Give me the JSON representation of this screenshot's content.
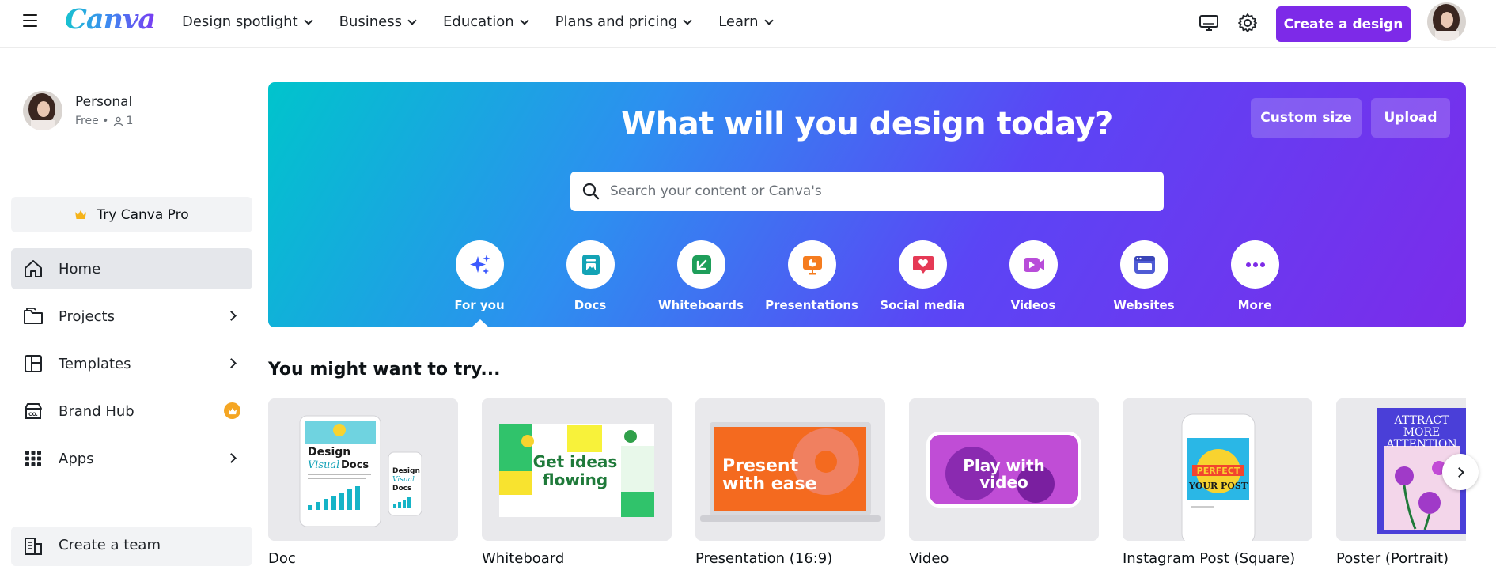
{
  "header": {
    "logo": "Canva",
    "menu": [
      {
        "label": "Design spotlight"
      },
      {
        "label": "Business"
      },
      {
        "label": "Education"
      },
      {
        "label": "Plans and pricing"
      },
      {
        "label": "Learn"
      }
    ],
    "create_button": "Create a design",
    "icons": [
      "monitor-icon",
      "gear-icon"
    ]
  },
  "sidebar": {
    "profile": {
      "name": "Personal",
      "plan": "Free",
      "members": "1"
    },
    "try_pro": "Try Canva Pro",
    "items": [
      {
        "label": "Home",
        "icon": "home-icon",
        "active": true
      },
      {
        "label": "Projects",
        "icon": "folder-icon"
      },
      {
        "label": "Templates",
        "icon": "templates-icon"
      },
      {
        "label": "Brand Hub",
        "icon": "brand-hub-icon"
      },
      {
        "label": "Apps",
        "icon": "apps-grid-icon"
      }
    ],
    "create_team": "Create a team"
  },
  "hero": {
    "title": "What will you design today?",
    "custom_size": "Custom size",
    "upload": "Upload",
    "search_placeholder": "Search your content or Canva's",
    "categories": [
      {
        "label": "For you",
        "icon": "sparkle-icon",
        "color": "#3d5afe",
        "selected": true
      },
      {
        "label": "Docs",
        "icon": "doc-icon",
        "color": "#13a3b5"
      },
      {
        "label": "Whiteboards",
        "icon": "whiteboard-icon",
        "color": "#1e9e5a"
      },
      {
        "label": "Presentations",
        "icon": "presentation-icon",
        "color": "#f57c1f"
      },
      {
        "label": "Social media",
        "icon": "heart-icon",
        "color": "#e53955"
      },
      {
        "label": "Videos",
        "icon": "video-icon",
        "color": "#b84cd9"
      },
      {
        "label": "Websites",
        "icon": "website-icon",
        "color": "#4f5bd5"
      },
      {
        "label": "More",
        "icon": "more-icon",
        "color": "#7d2ae8"
      }
    ]
  },
  "suggestions": {
    "title": "You might want to try...",
    "items": [
      {
        "label": "Doc",
        "thumb_text": "Design Visual Docs"
      },
      {
        "label": "Whiteboard",
        "thumb_text": "Get ideas flowing"
      },
      {
        "label": "Presentation (16:9)",
        "thumb_text": "Present with ease"
      },
      {
        "label": "Video",
        "thumb_text": "Play with video"
      },
      {
        "label": "Instagram Post (Square)",
        "thumb_text": "PERFECT YOUR POST"
      },
      {
        "label": "Poster (Portrait)",
        "thumb_text": "ATTRACT MORE ATTENTION"
      }
    ]
  },
  "colors": {
    "accent": "#7d2ae8",
    "hero_start": "#00c4cc",
    "hero_end": "#7b2cea"
  }
}
